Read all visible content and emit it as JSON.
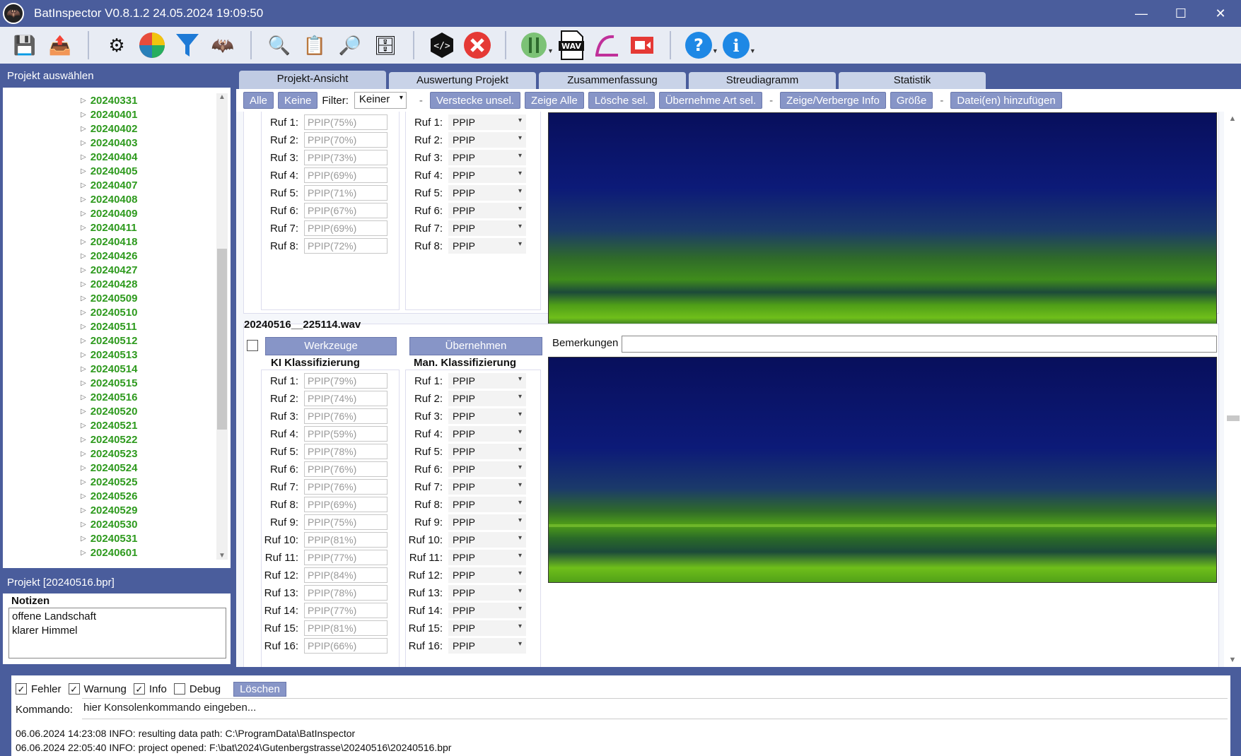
{
  "window": {
    "title": "BatInspector V0.8.1.2 24.05.2024 19:09:50",
    "minimize": "—",
    "maximize": "☐",
    "close": "✕"
  },
  "toolbar": {
    "icons": [
      "save-icon",
      "export-icon",
      "settings-icon",
      "color-wheel-icon",
      "filter-icon",
      "bat-icon",
      "search-ki-icon",
      "report-icon",
      "search-db-icon",
      "database-settings-icon",
      "script-icon",
      "cancel-icon",
      "tools-icon",
      "wav-icon",
      "sweep-icon",
      "record-icon",
      "help-icon",
      "info-icon"
    ],
    "wav_label": "WAV"
  },
  "left_panel": {
    "header": "Projekt auswählen",
    "tree_items": [
      "20240331",
      "20240401",
      "20240402",
      "20240403",
      "20240404",
      "20240405",
      "20240407",
      "20240408",
      "20240409",
      "20240411",
      "20240418",
      "20240426",
      "20240427",
      "20240428",
      "20240509",
      "20240510",
      "20240511",
      "20240512",
      "20240513",
      "20240514",
      "20240515",
      "20240516",
      "20240520",
      "20240521",
      "20240522",
      "20240523",
      "20240524",
      "20240525",
      "20240526",
      "20240529",
      "20240530",
      "20240531",
      "20240601"
    ],
    "project_header": "Projekt [20240516.bpr]",
    "notes_label": "Notizen",
    "notes": [
      "offene Landschaft",
      "klarer Himmel"
    ]
  },
  "tabs": [
    "Projekt-Ansicht",
    "Auswertung Projekt",
    "Zusammenfassung",
    "Streudiagramm",
    "Statistik"
  ],
  "actionbar": {
    "alle": "Alle",
    "keine": "Keine",
    "filter_label": "Filter:",
    "filter_value": "Keiner",
    "dash": "-",
    "verstecke": "Verstecke unsel.",
    "zeige_alle": "Zeige Alle",
    "loesche": "Lösche sel.",
    "uebernehme": "Übernehme Art sel.",
    "zeige_info": "Zeige/Verberge Info",
    "groesse": "Größe",
    "datei": "Datei(en) hinzufügen"
  },
  "card1": {
    "calls": [
      {
        "label": "Ruf 1:",
        "ki": "PPIP(75%)",
        "man": "PPIP"
      },
      {
        "label": "Ruf 2:",
        "ki": "PPIP(70%)",
        "man": "PPIP"
      },
      {
        "label": "Ruf 3:",
        "ki": "PPIP(73%)",
        "man": "PPIP"
      },
      {
        "label": "Ruf 4:",
        "ki": "PPIP(69%)",
        "man": "PPIP"
      },
      {
        "label": "Ruf 5:",
        "ki": "PPIP(71%)",
        "man": "PPIP"
      },
      {
        "label": "Ruf 6:",
        "ki": "PPIP(67%)",
        "man": "PPIP"
      },
      {
        "label": "Ruf 7:",
        "ki": "PPIP(69%)",
        "man": "PPIP"
      },
      {
        "label": "Ruf 8:",
        "ki": "PPIP(72%)",
        "man": "PPIP"
      }
    ]
  },
  "card2": {
    "filename": "20240516__225114.wav",
    "werkzeuge": "Werkzeuge",
    "uebernehmen": "Übernehmen",
    "bemerkungen": "Bemerkungen",
    "ki_head": "KI Klassifizierung",
    "man_head": "Man. Klassifizierung",
    "calls": [
      {
        "label": "Ruf 1:",
        "ki": "PPIP(79%)",
        "man": "PPIP"
      },
      {
        "label": "Ruf 2:",
        "ki": "PPIP(74%)",
        "man": "PPIP"
      },
      {
        "label": "Ruf 3:",
        "ki": "PPIP(76%)",
        "man": "PPIP"
      },
      {
        "label": "Ruf 4:",
        "ki": "PPIP(59%)",
        "man": "PPIP"
      },
      {
        "label": "Ruf 5:",
        "ki": "PPIP(78%)",
        "man": "PPIP"
      },
      {
        "label": "Ruf 6:",
        "ki": "PPIP(76%)",
        "man": "PPIP"
      },
      {
        "label": "Ruf 7:",
        "ki": "PPIP(76%)",
        "man": "PPIP"
      },
      {
        "label": "Ruf 8:",
        "ki": "PPIP(69%)",
        "man": "PPIP"
      },
      {
        "label": "Ruf 9:",
        "ki": "PPIP(75%)",
        "man": "PPIP"
      },
      {
        "label": "Ruf 10:",
        "ki": "PPIP(81%)",
        "man": "PPIP"
      },
      {
        "label": "Ruf 11:",
        "ki": "PPIP(77%)",
        "man": "PPIP"
      },
      {
        "label": "Ruf 12:",
        "ki": "PPIP(84%)",
        "man": "PPIP"
      },
      {
        "label": "Ruf 13:",
        "ki": "PPIP(78%)",
        "man": "PPIP"
      },
      {
        "label": "Ruf 14:",
        "ki": "PPIP(77%)",
        "man": "PPIP"
      },
      {
        "label": "Ruf 15:",
        "ki": "PPIP(81%)",
        "man": "PPIP"
      },
      {
        "label": "Ruf 16:",
        "ki": "PPIP(66%)",
        "man": "PPIP"
      }
    ]
  },
  "log": {
    "fehler": "Fehler",
    "warnung": "Warnung",
    "info": "Info",
    "debug": "Debug",
    "loeschen": "Löschen",
    "kommando_label": "Kommando:",
    "kommando_value": "hier Konsolenkommando eingeben...",
    "lines": [
      "06.06.2024 14:23:08  INFO: resulting data path: C:\\ProgramData\\BatInspector",
      "06.06.2024 22:05:40  INFO: project opened: F:\\bat\\2024\\Gutenbergstrasse\\20240516\\20240516.bpr"
    ]
  },
  "colors": {
    "accent": "#4a5d9c",
    "button": "#8795c7",
    "tree_green": "#2e9a1e",
    "spectro_dark": "#0a1260",
    "spectro_green": "#6fbf1a"
  }
}
